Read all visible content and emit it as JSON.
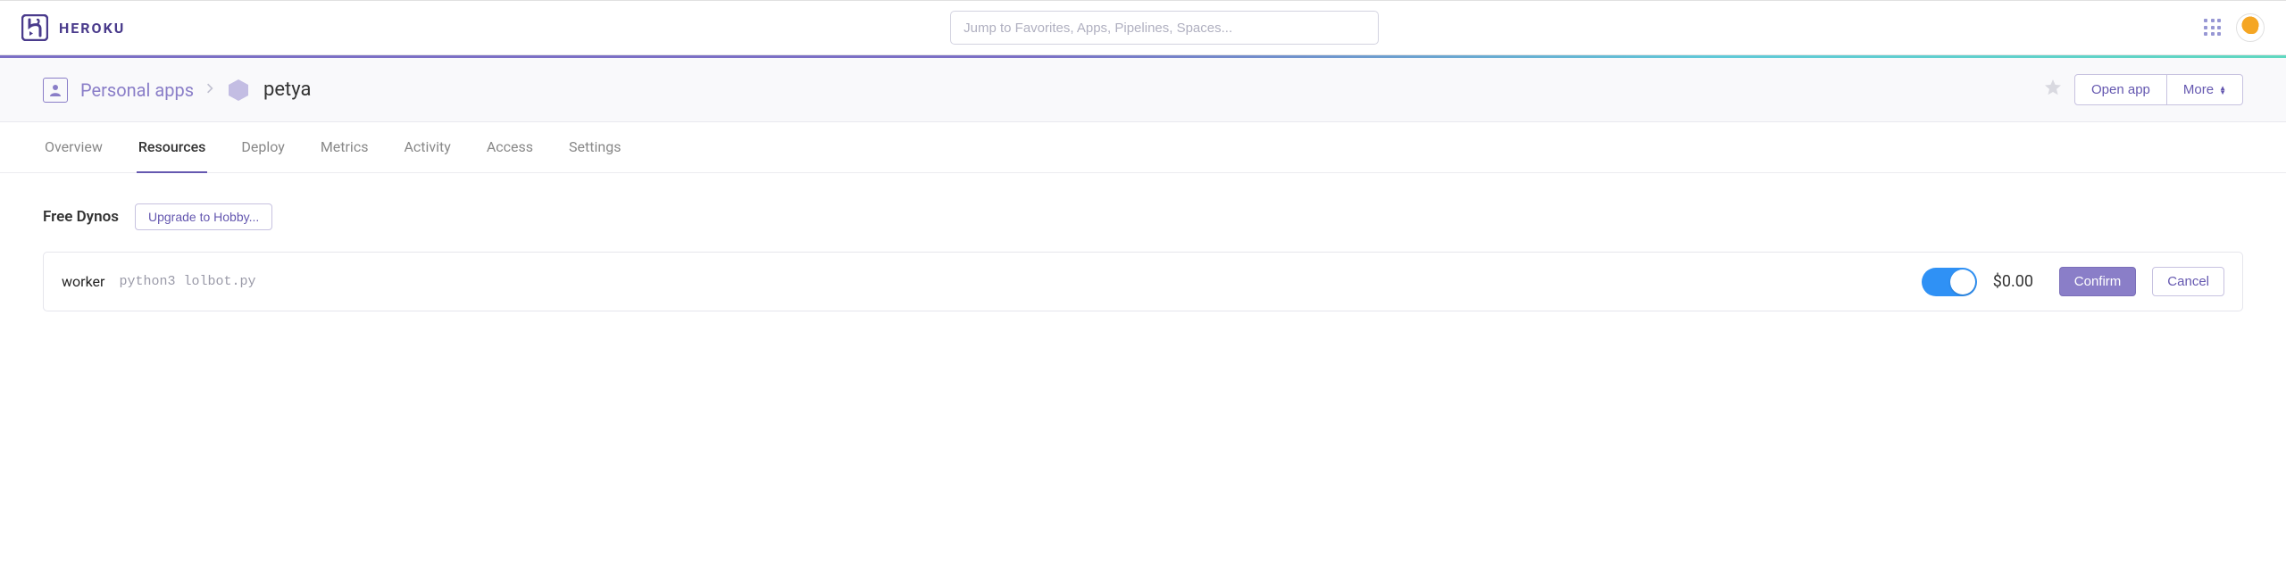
{
  "brand": {
    "name": "HEROKU"
  },
  "search": {
    "placeholder": "Jump to Favorites, Apps, Pipelines, Spaces..."
  },
  "breadcrumb": {
    "root": "Personal apps",
    "app": "petya"
  },
  "actions": {
    "open": "Open app",
    "more": "More"
  },
  "tabs": [
    {
      "id": "overview",
      "label": "Overview",
      "active": false
    },
    {
      "id": "resources",
      "label": "Resources",
      "active": true
    },
    {
      "id": "deploy",
      "label": "Deploy",
      "active": false
    },
    {
      "id": "metrics",
      "label": "Metrics",
      "active": false
    },
    {
      "id": "activity",
      "label": "Activity",
      "active": false
    },
    {
      "id": "access",
      "label": "Access",
      "active": false
    },
    {
      "id": "settings",
      "label": "Settings",
      "active": false
    }
  ],
  "dynos": {
    "section_title": "Free Dynos",
    "upgrade_label": "Upgrade to Hobby...",
    "rows": [
      {
        "name": "worker",
        "command": "python3 lolbot.py",
        "on": true,
        "price": "$0.00",
        "confirm_label": "Confirm",
        "cancel_label": "Cancel"
      }
    ]
  }
}
